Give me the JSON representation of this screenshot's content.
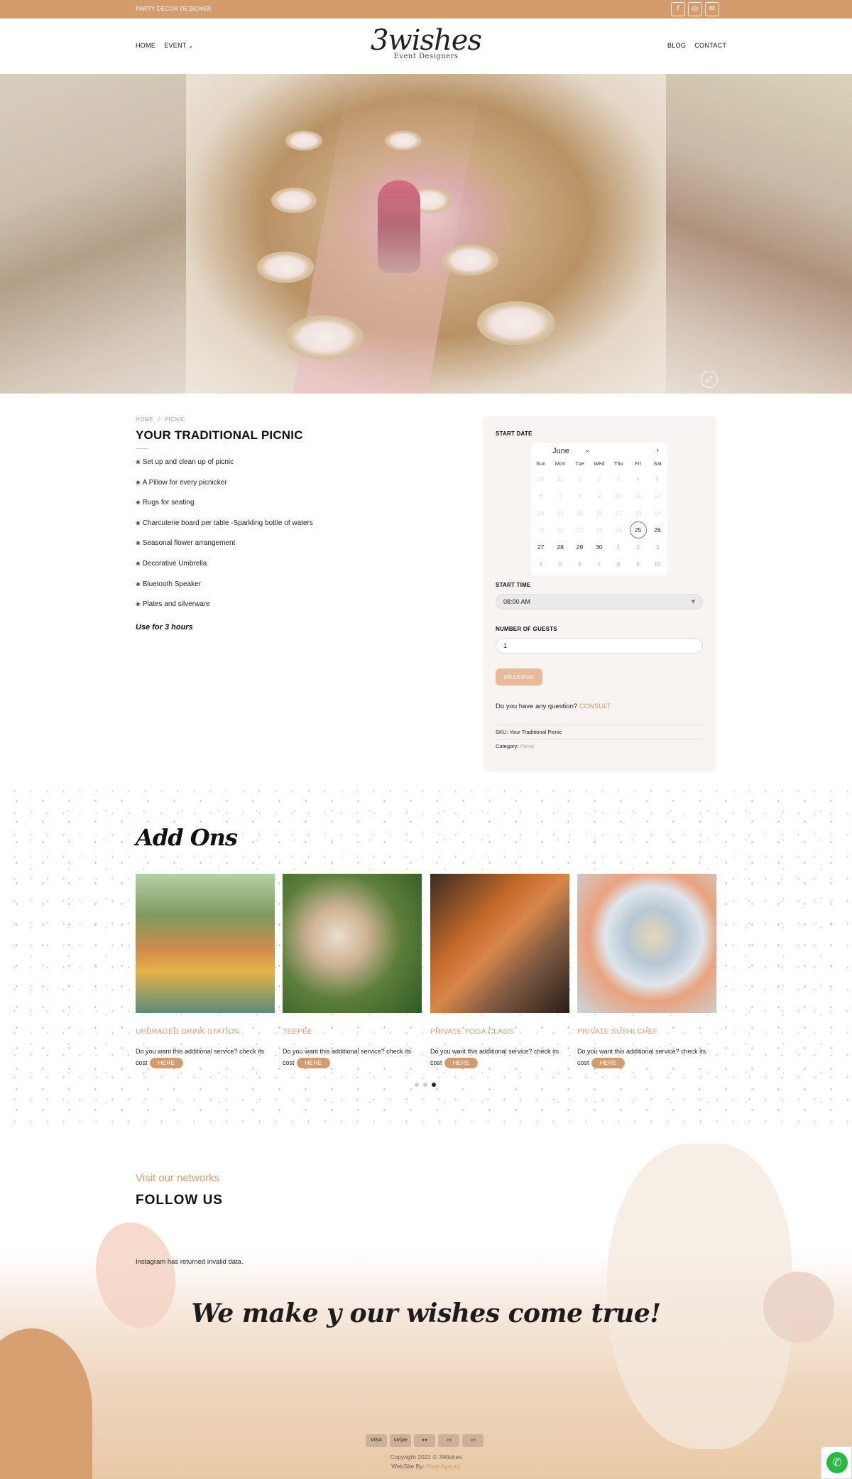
{
  "topbar": {
    "tagline": "PARTY DECOR DESIGNER",
    "social_icons": [
      "facebook-icon",
      "instagram-icon",
      "envelope-icon"
    ],
    "social_glyphs": [
      "f",
      "◎",
      "✉"
    ]
  },
  "header": {
    "nav_left": [
      "HOME",
      "EVENT"
    ],
    "event_chevron": "⌄",
    "nav_right": [
      "BLOG",
      "CONTACT"
    ],
    "logo_main": "3wishes",
    "logo_sub": "Event Designers"
  },
  "hero": {
    "expand_glyph": "⤢"
  },
  "product": {
    "breadcrumb": [
      "HOME",
      "PICNIC"
    ],
    "breadcrumb_sep": "/",
    "title": "YOUR TRADITIONAL PICNIC",
    "bullet": "❀",
    "features": [
      "Set up and clean up of picnic",
      "A Pillow for every picnicker",
      "Rugs for seating",
      "Charcuterie board per table -Sparkling bottle of waters",
      "Seasonal flower arrangement",
      "Decorative Umbrella",
      "Bluetooth Speaker",
      "Plates and silverware"
    ],
    "use_for": "Use for 3 hours"
  },
  "booking": {
    "start_date_label": "START DATE",
    "calendar": {
      "month": "June",
      "month_chevron": "⌄",
      "next_glyph": "›",
      "weekdays": [
        "Sun",
        "Mon",
        "Tue",
        "Wed",
        "Thu",
        "Fri",
        "Sat"
      ],
      "weeks": [
        [
          "30",
          "31",
          "1",
          "2",
          "3",
          "4",
          "5"
        ],
        [
          "6",
          "7",
          "8",
          "9",
          "10",
          "11",
          "12"
        ],
        [
          "13",
          "14",
          "15",
          "16",
          "17",
          "18",
          "19"
        ],
        [
          "20",
          "21",
          "22",
          "23",
          "24",
          "25",
          "26"
        ],
        [
          "27",
          "28",
          "29",
          "30",
          "1",
          "2",
          "3"
        ],
        [
          "4",
          "5",
          "6",
          "7",
          "8",
          "9",
          "10"
        ]
      ],
      "selected_day": "25"
    },
    "start_time_label": "START TIME",
    "start_time_value": "08:00 AM",
    "guests_label": "NUMBER OF GUESTS",
    "guests_value": "1",
    "reserve_label": "RESERVE",
    "question_text": "Do you have any question?",
    "consult_label": "CONSULT",
    "sku_label": "SKU:",
    "sku_value": "Your Traditional Picnic",
    "category_label": "Category:",
    "category_value": "Picnic"
  },
  "addons": {
    "title": "Add Ons",
    "cards": [
      {
        "title": "UPDRAGED DRINK STATION",
        "desc": "Do you want this additional service? check its cost",
        "button": "HERE"
      },
      {
        "title": "TEEPEE",
        "desc": "Do you want this additional service? check its cost",
        "button": "HERE"
      },
      {
        "title": "PRIVATE YOGA CLASS",
        "desc": "Do you want this additional service? check its cost",
        "button": "HERE"
      },
      {
        "title": "PRIVATE SUSHI CHEF",
        "desc": "Do you want this additional service? check its cost",
        "button": "HERE"
      }
    ],
    "pagination_active": 3
  },
  "follow": {
    "kicker": "Visit our networks",
    "title": "FOLLOW US",
    "instagram_message": "Instagram has returned invalid data."
  },
  "banner": {
    "tagline": "We make y our wishes come true!"
  },
  "footer": {
    "payments": [
      "VISA",
      "stripe",
      "",
      "",
      ""
    ],
    "copyright": "Copyright 2021 © 3Wishes",
    "website_by": "WebSite By:",
    "agency": "Pixel Agency",
    "whatsapp_glyph": "✆"
  }
}
